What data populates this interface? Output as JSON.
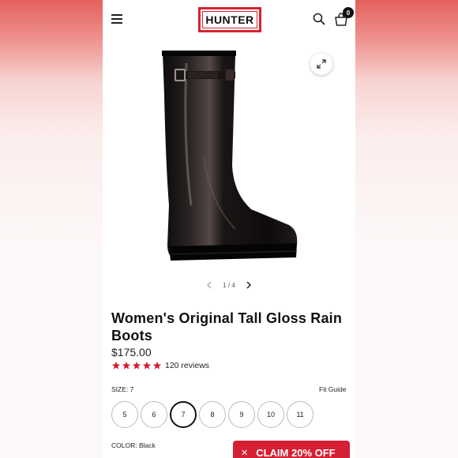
{
  "header": {
    "logo_text": "HUNTER",
    "cart_count": "0",
    "brand_color": "#d6232f"
  },
  "gallery": {
    "current": "1",
    "separator": "/",
    "total": "4"
  },
  "product": {
    "title": "Women's Original Tall Gloss Rain Boots",
    "price": "$175.00",
    "rating": 5,
    "reviews_text": "120 reviews",
    "star_color": "#d51f34"
  },
  "size": {
    "label": "SIZE: 7",
    "fit_guide": "Fit Guide",
    "options": [
      "5",
      "6",
      "7",
      "8",
      "9",
      "10",
      "11"
    ],
    "selected": "7"
  },
  "color": {
    "label": "COLOR:",
    "value": "Black"
  },
  "promo": {
    "close_icon": "close-icon",
    "label": "CLAIM 20% OFF"
  }
}
